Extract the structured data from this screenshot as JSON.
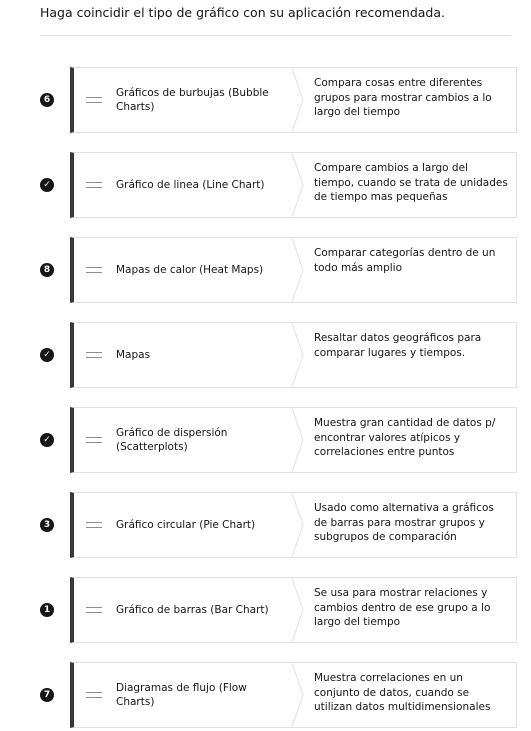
{
  "prompt": "Haga coincidir el tipo de gráfico con su aplicación recomendada.",
  "items": [
    {
      "badge": "6",
      "name": "Gráficos de burbujas (Bubble Charts)",
      "desc": "Compara cosas entre diferentes grupos para mostrar cambios a lo largo del tiempo"
    },
    {
      "badge": "✓",
      "name": "Gráfico de linea (Line Chart)",
      "desc": "Compare cambios a largo del tiempo, cuando se trata de unidades de tiempo mas pequeñas"
    },
    {
      "badge": "8",
      "name": "Mapas de calor (Heat Maps)",
      "desc": "Comparar categorías dentro de un todo más amplio"
    },
    {
      "badge": "✓",
      "name": "Mapas",
      "desc": "Resaltar datos geográficos para comparar lugares y tiempos."
    },
    {
      "badge": "✓",
      "name": "Gráfico de dispersión (Scatterplots)",
      "desc": "Muestra gran cantidad de datos p/ encontrar valores atípicos y correlaciones entre puntos"
    },
    {
      "badge": "3",
      "name": "Gráfico circular (Pie Chart)",
      "desc": "Usado como alternativa a gráficos de barras para mostrar grupos y subgrupos de comparación"
    },
    {
      "badge": "1",
      "name": "Gráfico de barras (Bar Chart)",
      "desc": "Se usa para mostrar relaciones y cambios dentro de ese grupo a lo largo del tiempo"
    },
    {
      "badge": "7",
      "name": "Diagramas de flujo (Flow Charts)",
      "desc": "Muestra correlaciones en un conjunto de datos, cuando se utilizan datos multidimensionales"
    }
  ]
}
